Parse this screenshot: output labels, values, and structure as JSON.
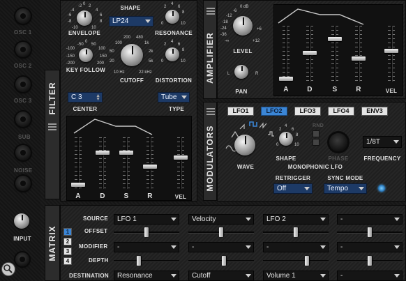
{
  "left_strip": {
    "knob_labels": [
      "OSC 1",
      "OSC 2",
      "OSC 3",
      "SUB",
      "NOISE"
    ],
    "input_label": "INPUT"
  },
  "filter": {
    "tab_label": "FILTER",
    "envelope": {
      "label": "ENVELOPE",
      "ticks": [
        "-2",
        "0",
        "2",
        "-4",
        "4",
        "-6",
        "6",
        "-8",
        "8",
        "-10",
        "10"
      ]
    },
    "shape": {
      "label": "SHAPE",
      "value": "LP24"
    },
    "resonance": {
      "label": "RESONANCE",
      "ticks": [
        "2",
        "4",
        "6",
        "0",
        "8",
        "10"
      ]
    },
    "key_follow": {
      "label": "KEY FOLLOW",
      "ticks": [
        "-50",
        "0",
        "50",
        "-100",
        "100",
        "-150",
        "150",
        "-200",
        "200"
      ]
    },
    "cutoff": {
      "label": "CUTOFF",
      "ticks": [
        "200",
        "480",
        "100",
        "1k",
        "50",
        "2k",
        "20",
        "5k",
        "10 Hz",
        "22 kHz"
      ]
    },
    "distortion": {
      "label": "DISTORTION",
      "ticks": [
        "2",
        "4",
        "6",
        "0",
        "8",
        "10"
      ]
    },
    "center": {
      "label": "CENTER",
      "value": "C 3"
    },
    "type": {
      "label": "TYPE",
      "value": "Tube"
    },
    "adsr_labels": [
      "A",
      "D",
      "S",
      "R"
    ],
    "vel_label": "VEL",
    "adsr_levels": [
      0.05,
      0.72,
      0.72,
      0.42
    ],
    "vel_level": 0.62
  },
  "amplifier": {
    "tab_label": "AMPLIFIER",
    "level": {
      "label": "LEVEL",
      "ticks": [
        "0 dB",
        "-6",
        "-12",
        "-18",
        "-24",
        "-36",
        "-∞",
        "+6",
        "+12"
      ]
    },
    "pan": {
      "label": "PAN",
      "ticks": [
        "L",
        "R"
      ]
    },
    "adsr_labels": [
      "A",
      "D",
      "S",
      "R"
    ],
    "vel_label": "VEL",
    "adsr_levels": [
      0.02,
      0.52,
      0.78,
      0.4
    ],
    "vel_level": 0.55
  },
  "modulators": {
    "tab_label": "MODULATORS",
    "tabs": [
      "LFO1",
      "LFO2",
      "LFO3",
      "LFO4",
      "ENV3"
    ],
    "active_tab": 1,
    "wave_label": "WAVE",
    "shape_label": "SHAPE",
    "shape_ticks": [
      "2",
      "4",
      "6",
      "0",
      "8",
      "10"
    ],
    "rnd_label": "RND",
    "phase_label": "PHASE",
    "section_label": "MONOPHONIC LFO",
    "frequency": {
      "label": "FREQUENCY",
      "value": "1/8T"
    },
    "retrigger": {
      "label": "RETRIGGER",
      "value": "Off"
    },
    "sync_mode": {
      "label": "SYNC MODE",
      "value": "Tempo"
    }
  },
  "matrix": {
    "tab_label": "MATRIX",
    "numbers": [
      "1",
      "2",
      "3",
      "4"
    ],
    "active_number": 0,
    "row_labels": [
      "SOURCE",
      "OFFSET",
      "MODIFIER",
      "DEPTH",
      "DESTINATION"
    ],
    "columns": [
      {
        "source": "LFO 1",
        "modifier": "-",
        "destination": "Resonance",
        "offset": 0.5,
        "depth": 0.38
      },
      {
        "source": "Velocity",
        "modifier": "-",
        "destination": "Cutoff",
        "offset": 0.5,
        "depth": 0.55
      },
      {
        "source": "LFO 2",
        "modifier": "-",
        "destination": "Volume 1",
        "offset": 0.5,
        "depth": 0.68
      },
      {
        "source": "-",
        "modifier": "-",
        "destination": "-",
        "offset": 0.5,
        "depth": 0.5
      }
    ]
  }
}
